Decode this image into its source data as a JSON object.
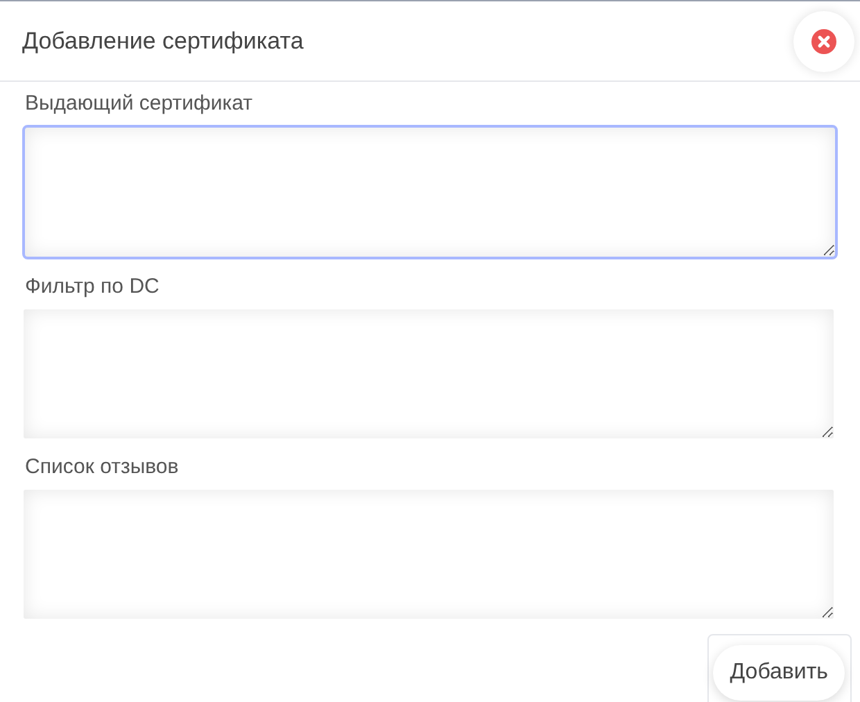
{
  "dialog": {
    "title": "Добавление сертификата"
  },
  "fields": [
    {
      "label": "Выдающий сертификат",
      "focused": true
    },
    {
      "label": "Фильтр по DC",
      "focused": false
    },
    {
      "label": "Список отзывов",
      "focused": false
    }
  ],
  "submit_button": {
    "label": "Добавить"
  }
}
